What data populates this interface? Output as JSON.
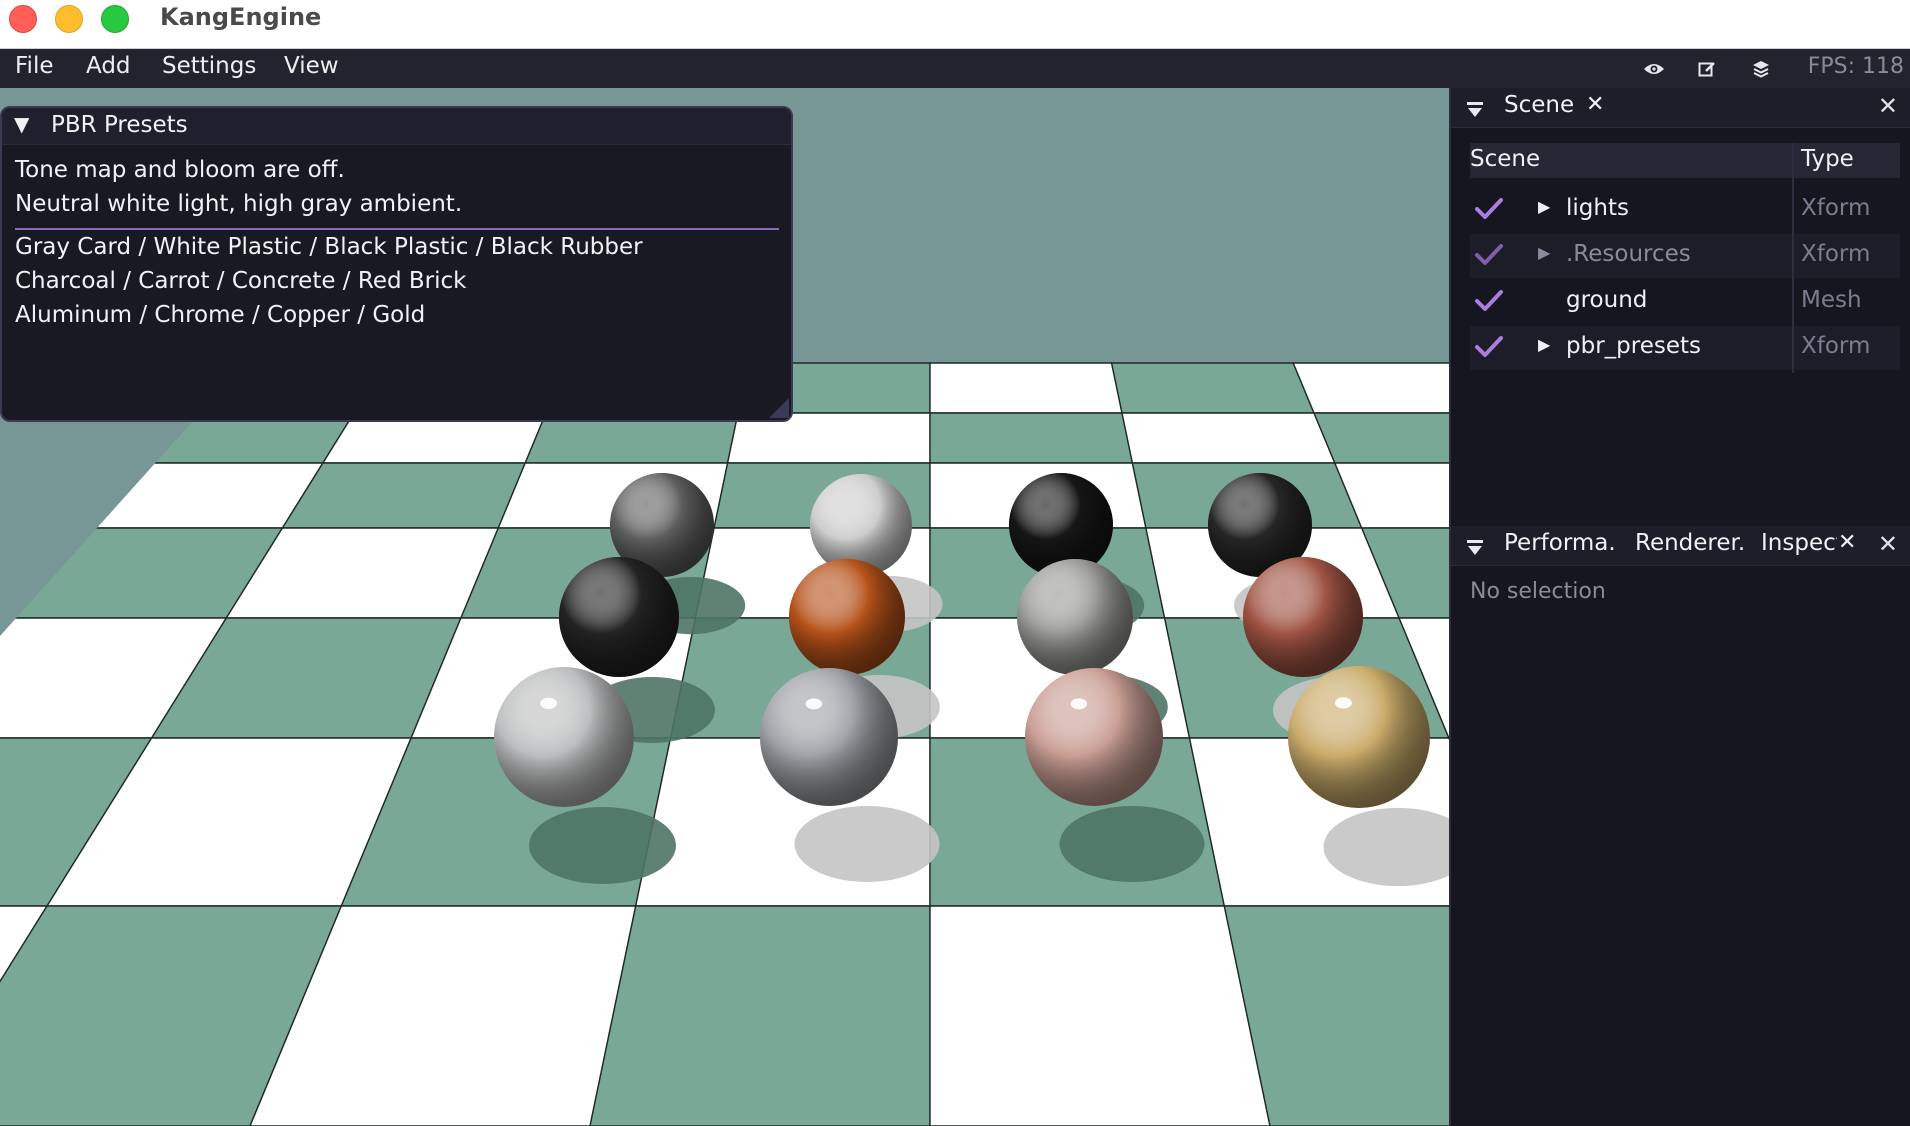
{
  "window": {
    "title": "KangEngine"
  },
  "menubar": {
    "items": [
      "File",
      "Add",
      "Settings",
      "View"
    ],
    "tools": [
      "eye-icon",
      "edit-icon",
      "layers-icon"
    ],
    "fps_label": "FPS: 118"
  },
  "pbr_panel": {
    "title": "PBR Presets",
    "lines": [
      "Tone map and bloom are off.",
      "Neutral white light, high gray ambient.",
      "Gray Card / White Plastic / Black Plastic / Black Rubber",
      "Charcoal / Carrot / Concrete / Red Brick",
      "Aluminum / Chrome / Copper / Gold"
    ]
  },
  "scene_panel": {
    "tab_label": "Scene",
    "columns": [
      "Scene",
      "Type"
    ],
    "rows": [
      {
        "name": "lights",
        "type": "Xform",
        "expandable": true,
        "dim": false
      },
      {
        "name": ".Resources",
        "type": "Xform",
        "expandable": true,
        "dim": true
      },
      {
        "name": "ground",
        "type": "Mesh",
        "expandable": false,
        "dim": false
      },
      {
        "name": "pbr_presets",
        "type": "Xform",
        "expandable": true,
        "dim": false
      }
    ]
  },
  "inspector_panel": {
    "tabs": [
      "Performa.",
      "Renderer.",
      "Inspect"
    ],
    "empty_text": "No selection"
  },
  "colors": {
    "accent": "#a97ee0",
    "sky": "#769795",
    "floor_green": "#7aa897",
    "floor_white": "#ffffff"
  },
  "viewport": {
    "spheres": [
      {
        "name": "gray-card-sphere",
        "color": "#5f5f5f"
      },
      {
        "name": "white-plastic-sphere",
        "color": "#cdcdcd"
      },
      {
        "name": "black-plastic-sphere",
        "color": "#161616"
      },
      {
        "name": "black-rubber-sphere",
        "color": "#262626"
      },
      {
        "name": "charcoal-sphere",
        "color": "#232323"
      },
      {
        "name": "carrot-sphere",
        "color": "#b5521a"
      },
      {
        "name": "concrete-sphere",
        "color": "#9a9a96"
      },
      {
        "name": "red-brick-sphere",
        "color": "#a05444"
      },
      {
        "name": "aluminum-sphere",
        "color": "#bcbdbe"
      },
      {
        "name": "chrome-sphere",
        "color": "#9ea1a5"
      },
      {
        "name": "copper-sphere",
        "color": "#c99d94"
      },
      {
        "name": "gold-sphere",
        "color": "#c9ab6a"
      }
    ]
  }
}
